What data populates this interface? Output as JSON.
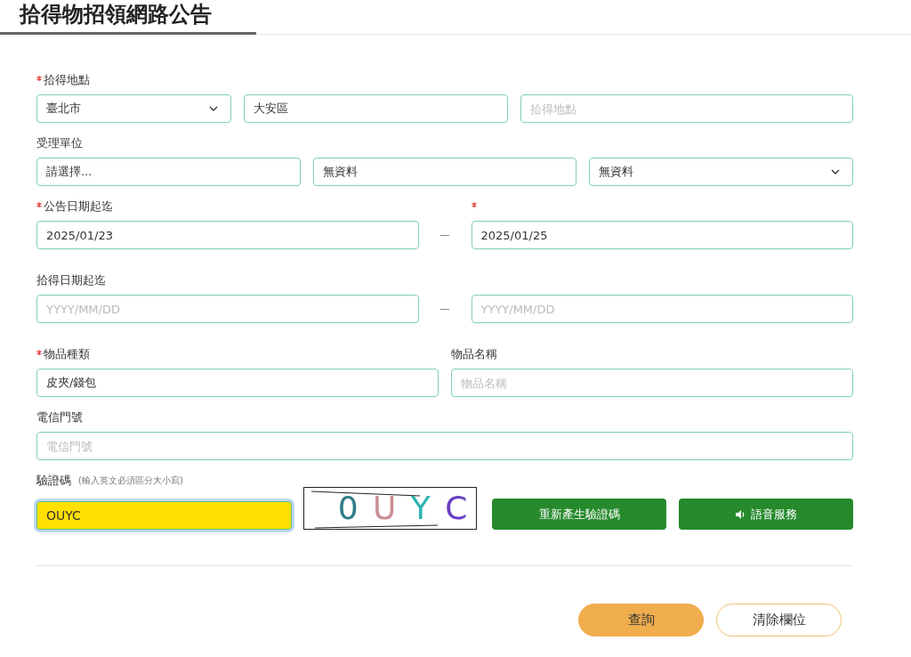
{
  "page_title": "拾得物招領網路公告",
  "groups": [
    {
      "kind": "location",
      "labels": [
        {
          "text": "拾得地點",
          "required": true
        }
      ],
      "fields": [
        {
          "kind": "select",
          "value": "臺北市"
        },
        {
          "kind": "input",
          "value": "大安區"
        },
        {
          "kind": "input",
          "placeholder": "拾得地點"
        }
      ]
    },
    {
      "kind": "unit",
      "labels": [
        {
          "text": "受理單位",
          "required": false
        }
      ],
      "fields": [
        {
          "kind": "input",
          "value": "請選擇..."
        },
        {
          "kind": "input",
          "value": "無資料"
        },
        {
          "kind": "select",
          "value": "無資料"
        }
      ]
    },
    {
      "kind": "range",
      "labels": [
        {
          "text": "公告日期起迄",
          "required": true
        },
        {
          "required": true
        }
      ],
      "fields": [
        {
          "kind": "input",
          "value": "2025/01/23"
        },
        {
          "kind": "input",
          "value": "2025/01/25"
        }
      ]
    },
    {
      "kind": "range",
      "labels": [
        {
          "text": "拾得日期起迄",
          "required": false
        }
      ],
      "fields": [
        {
          "kind": "input",
          "placeholder": "YYYY/MM/DD"
        },
        {
          "kind": "input",
          "placeholder": "YYYY/MM/DD"
        }
      ]
    },
    {
      "kind": "pair",
      "labels": [
        {
          "text": "物品種類",
          "required": true
        },
        {
          "text": "物品名稱",
          "required": false
        }
      ],
      "fields": [
        {
          "kind": "input",
          "value": "皮夾/錢包"
        },
        {
          "kind": "input",
          "placeholder": "物品名稱"
        }
      ]
    },
    {
      "kind": "single",
      "labels": [
        {
          "text": "電信門號",
          "required": false
        }
      ],
      "fields": [
        {
          "kind": "input",
          "placeholder": "電信門號"
        }
      ]
    }
  ],
  "captcha": {
    "label": "驗證碼",
    "hint": "(輸入英文必須區分大小寫)",
    "value": "OUYC",
    "focused": true,
    "characters": [
      {
        "char": "0",
        "color": "#2e7d86"
      },
      {
        "char": "U",
        "color": "#c98f95"
      },
      {
        "char": "Y",
        "color": "#2bb5b0"
      },
      {
        "char": "C",
        "color": "#6a3fc4"
      }
    ],
    "buttons": [
      {
        "label": "重新產生驗證碼",
        "kind": "refresh"
      },
      {
        "label": "語音服務",
        "kind": "audio"
      }
    ]
  },
  "actions": [
    {
      "label": "查詢",
      "kind": "primary"
    },
    {
      "label": "清除欄位",
      "kind": "secondary"
    }
  ]
}
